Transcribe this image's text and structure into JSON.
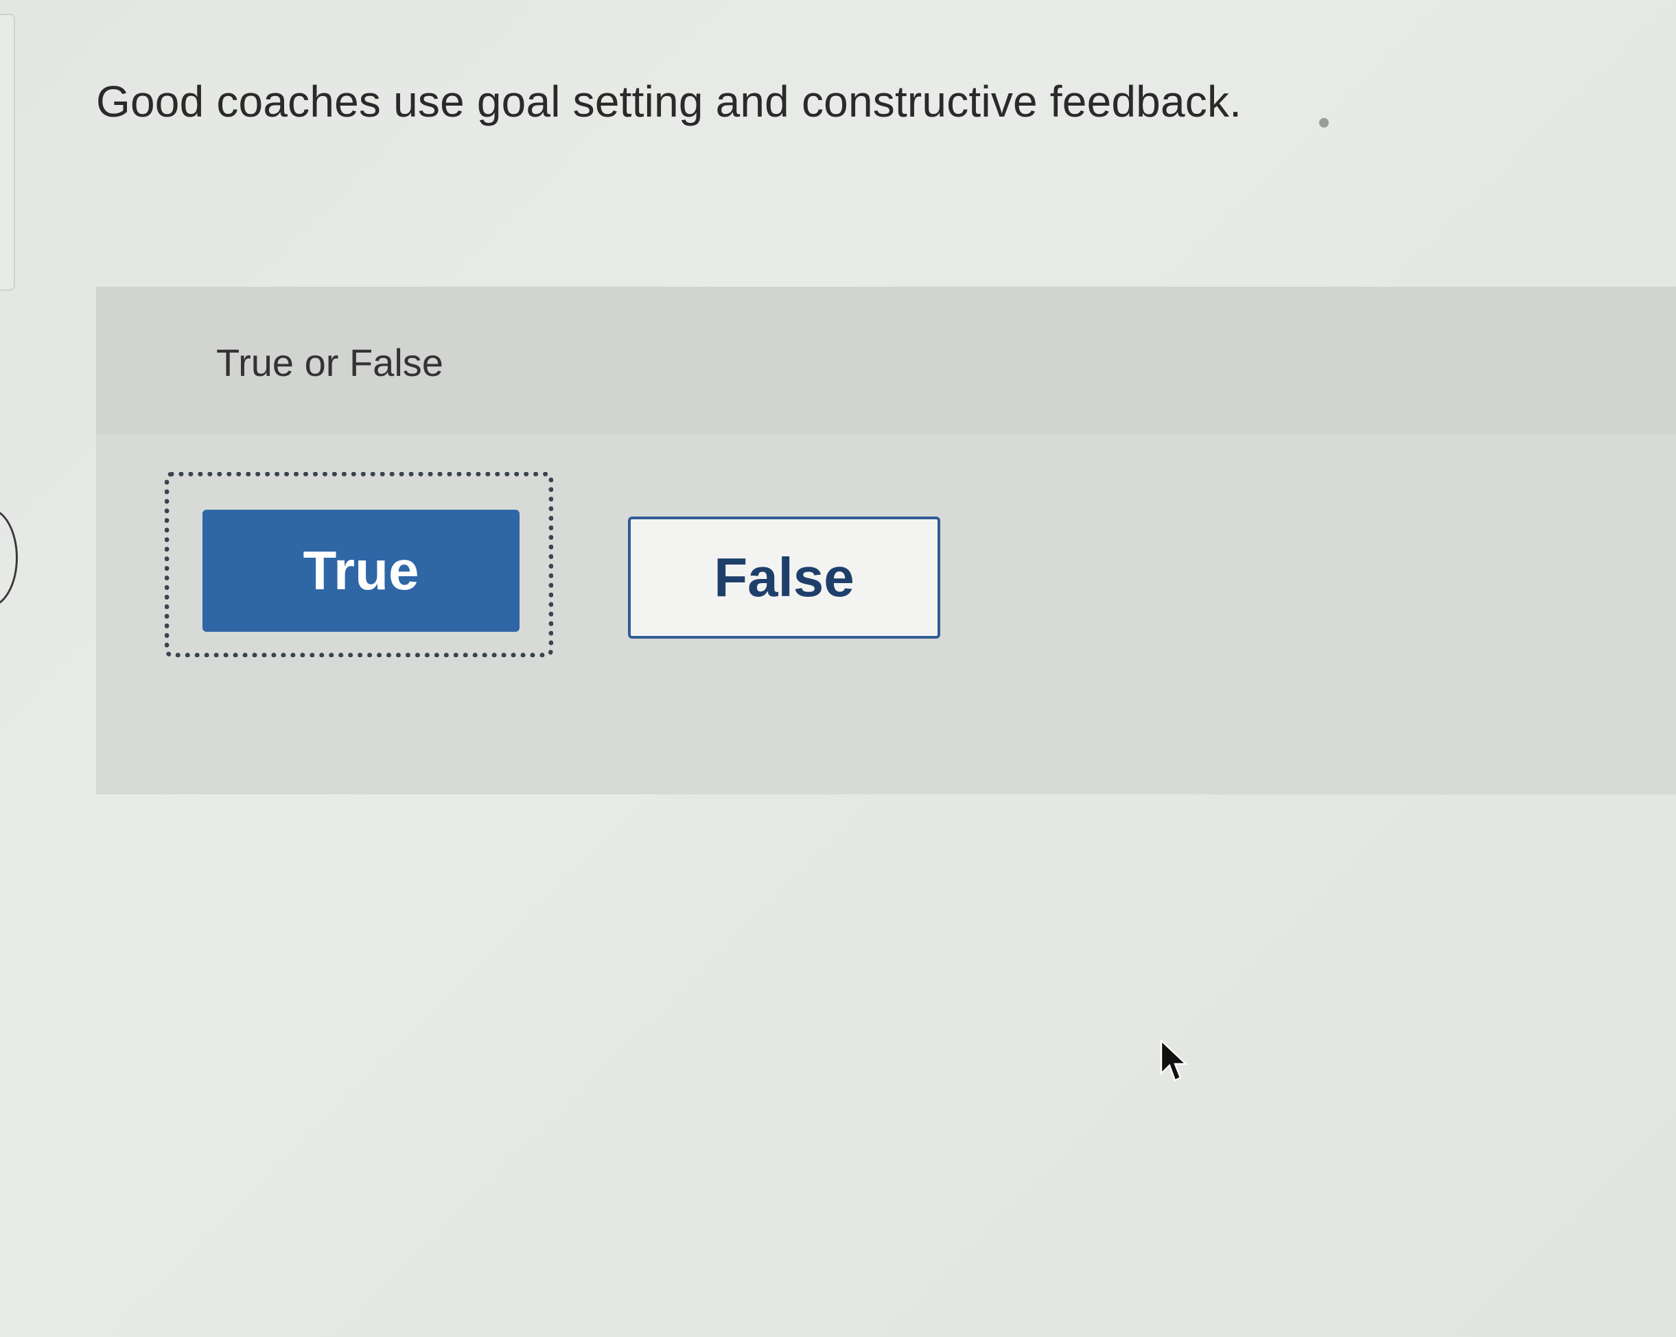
{
  "question": {
    "text": "Good coaches use goal setting and constructive feedback."
  },
  "answer_panel": {
    "instruction": "True or False",
    "options": [
      {
        "label": "True",
        "selected": true
      },
      {
        "label": "False",
        "selected": false
      }
    ]
  },
  "colors": {
    "primary_blue": "#2f66a6",
    "false_text": "#1f3f6b",
    "panel_bg": "#d8dad7"
  },
  "icons": {
    "cursor": "mouse-pointer-icon"
  }
}
